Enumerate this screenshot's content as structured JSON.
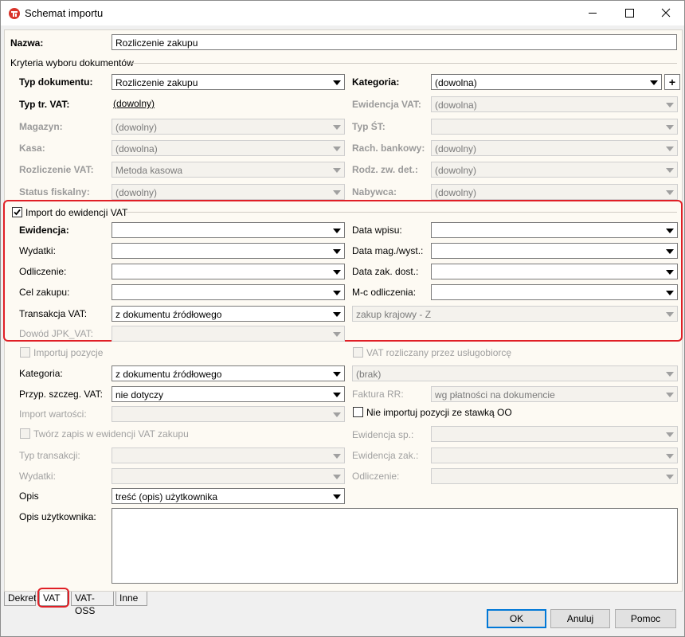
{
  "window": {
    "title": "Schemat importu"
  },
  "name": {
    "label": "Nazwa:",
    "value": "Rozliczenie zakupu"
  },
  "criteria": {
    "title": "Kryteria wyboru dokumentów",
    "typ_dok_label": "Typ dokumentu:",
    "typ_dok_value": "Rozliczenie zakupu",
    "kategoria_label": "Kategoria:",
    "kategoria_value": "(dowolna)",
    "typ_tr_label": "Typ tr. VAT:",
    "typ_tr_value": "(dowolny)",
    "ewidencja_vat_label": "Ewidencja VAT:",
    "ewidencja_vat_value": "(dowolna)",
    "magazyn_label": "Magazyn:",
    "magazyn_value": "(dowolny)",
    "typ_st_label": "Typ ŚT:",
    "typ_st_value": "",
    "kasa_label": "Kasa:",
    "kasa_value": "(dowolna)",
    "rach_label": "Rach. bankowy:",
    "rach_value": "(dowolny)",
    "rozl_label": "Rozliczenie VAT:",
    "rozl_value": "Metoda kasowa",
    "rodz_label": "Rodz. zw. det.:",
    "rodz_value": "(dowolny)",
    "status_label": "Status fiskalny:",
    "status_value": "(dowolny)",
    "nabywca_label": "Nabywca:",
    "nabywca_value": "(dowolny)"
  },
  "vat_import": {
    "checkbox_label": "Import do ewidencji VAT",
    "checked": true,
    "ewidencja_label": "Ewidencja:",
    "ewidencja_value": "",
    "data_wpisu_label": "Data wpisu:",
    "data_wpisu_value": "",
    "wydatki_label": "Wydatki:",
    "wydatki_value": "",
    "data_mag_label": "Data mag./wyst.:",
    "data_mag_value": "",
    "odliczenie_label": "Odliczenie:",
    "odliczenie_value": "",
    "data_zak_label": "Data zak. dost.:",
    "data_zak_value": "",
    "cel_label": "Cel zakupu:",
    "cel_value": "",
    "mc_label": "M-c odliczenia:",
    "mc_value": "",
    "transakcja_label": "Transakcja VAT:",
    "transakcja_value": "z dokumentu źródłowego",
    "transakcja_right_value": "zakup krajowy - Z",
    "dowod_label": "Dowód JPK_VAT:",
    "dowod_value": ""
  },
  "positions": {
    "importuj_label": "Importuj pozycje",
    "vat_rozl_label": "VAT rozliczany przez usługobiorcę",
    "kategoria_label": "Kategoria:",
    "kategoria_value": "z dokumentu źródłowego",
    "kategoria_right_value": "(brak)",
    "przyp_label": "Przyp. szczeg. VAT:",
    "przyp_value": "nie dotyczy",
    "faktura_label": "Faktura RR:",
    "faktura_value": "wg płatności na dokumencie",
    "import_wart_label": "Import wartości:",
    "import_wart_value": "",
    "nie_importuj_label": "Nie importuj pozycji ze stawką OO",
    "tworz_label": "Twórz zapis w ewidencji VAT zakupu",
    "ewidencja_sp_label": "Ewidencja sp.:",
    "ewidencja_sp_value": "",
    "typ_trans_label": "Typ transakcji:",
    "typ_trans_value": "",
    "ewidencja_zak_label": "Ewidencja zak.:",
    "ewidencja_zak_value": "",
    "wydatki_label": "Wydatki:",
    "wydatki_value": "",
    "odliczenie_label": "Odliczenie:",
    "odliczenie_value": "",
    "opis_label": "Opis",
    "opis_value": "treść (opis) użytkownika",
    "opis_uzyt_label": "Opis użytkownika:"
  },
  "tabs": [
    "Dekret",
    "VAT",
    "VAT-OSS",
    "Inne"
  ],
  "buttons": {
    "ok": "OK",
    "cancel": "Anuluj",
    "help": "Pomoc"
  },
  "colors": {
    "highlight": "#e01f26",
    "panel": "#fdfaf3",
    "focus": "#0078d7"
  }
}
